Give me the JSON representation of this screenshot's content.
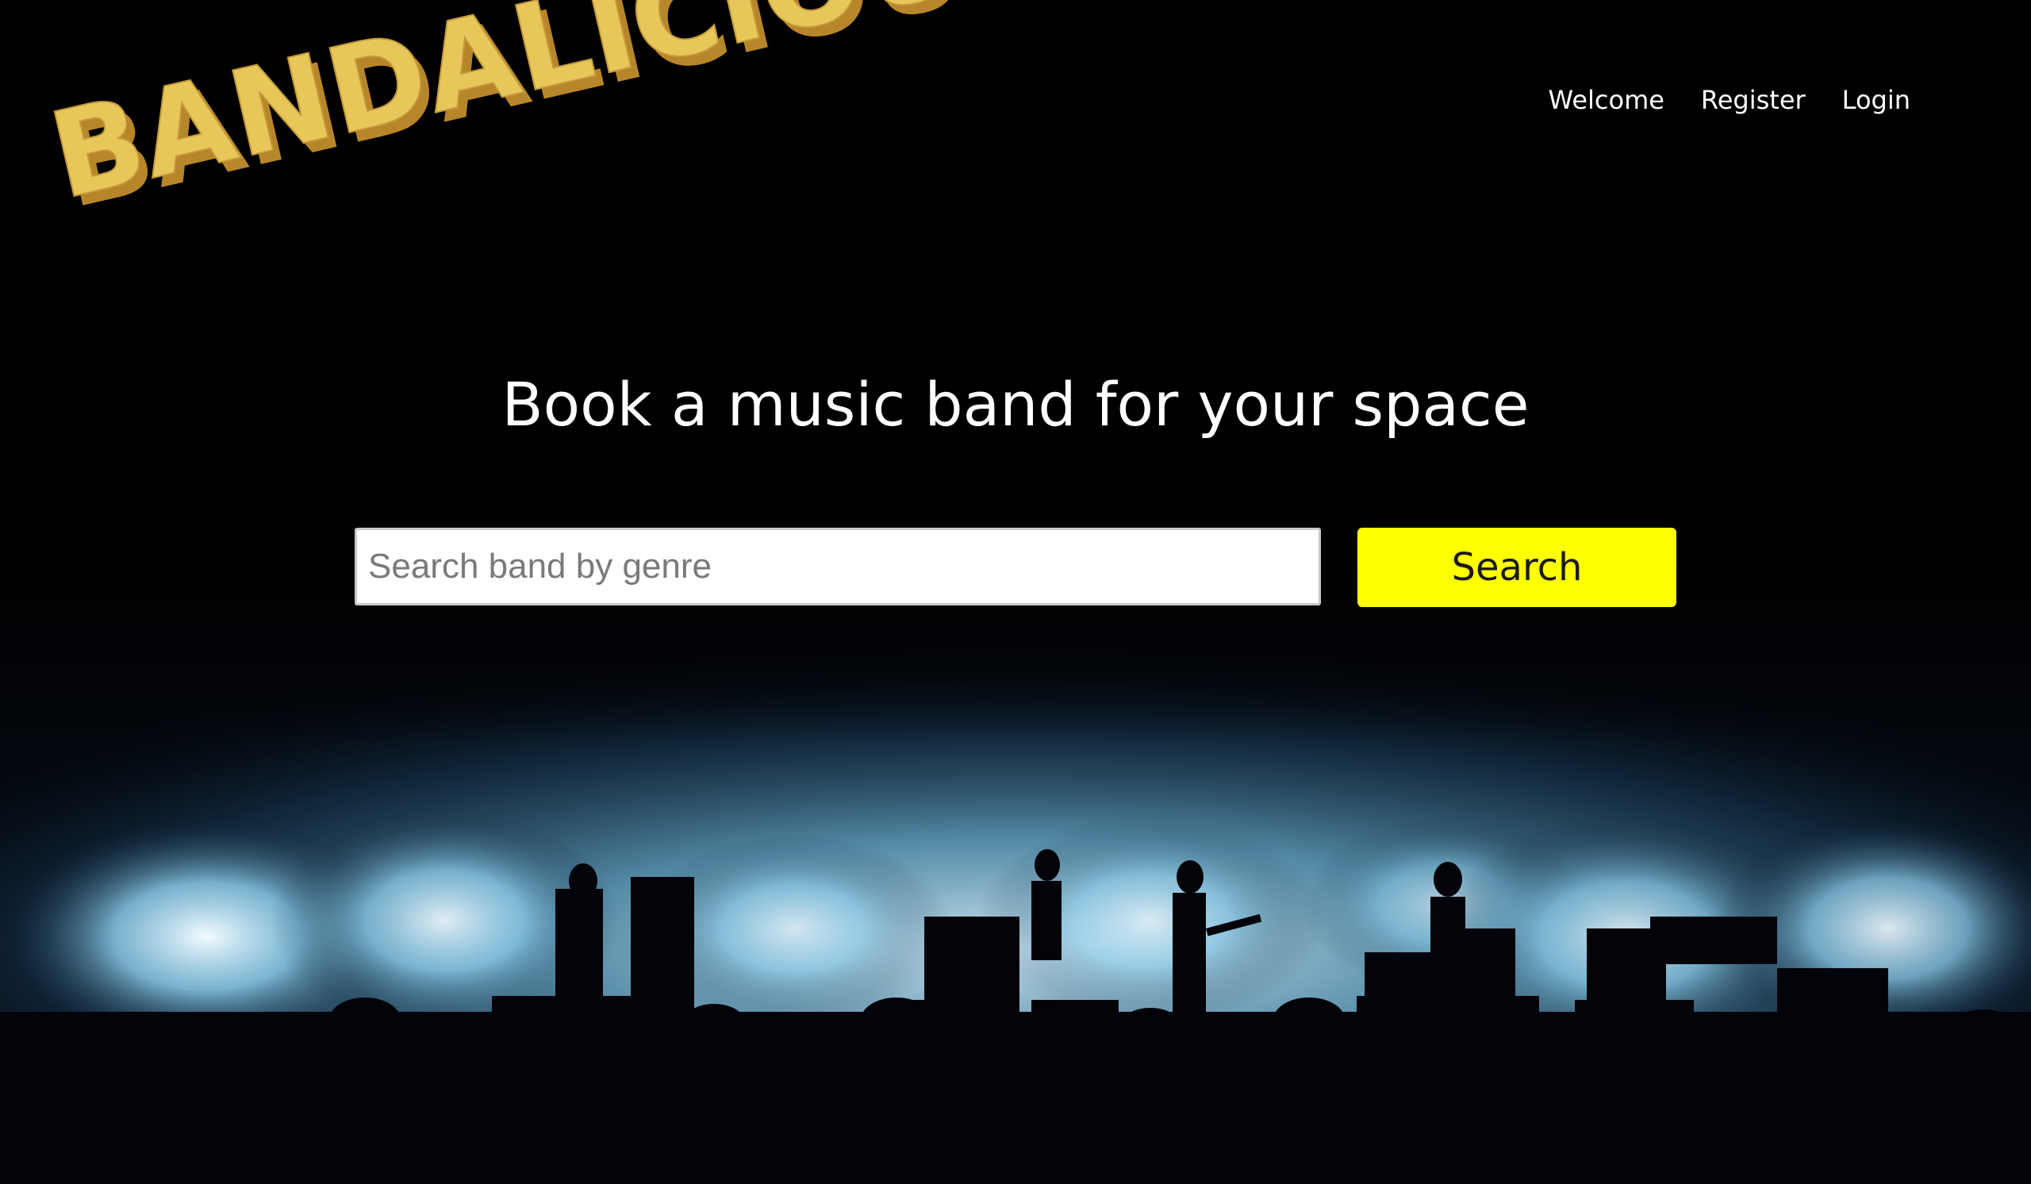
{
  "brand": {
    "logo_text": "BANDALICIOUS",
    "logo_color": "#e8c75a",
    "logo_shadow_color": "#b8862a"
  },
  "nav": {
    "items": [
      {
        "label": "Welcome"
      },
      {
        "label": "Register"
      },
      {
        "label": "Login"
      }
    ]
  },
  "hero": {
    "headline": "Book a music band for your space",
    "search": {
      "placeholder": "Search band by genre",
      "value": "",
      "button_label": "Search",
      "button_color": "#ffff00"
    }
  },
  "background": {
    "icon": "concert-stage-image",
    "light_color": "#bfe6ff"
  }
}
